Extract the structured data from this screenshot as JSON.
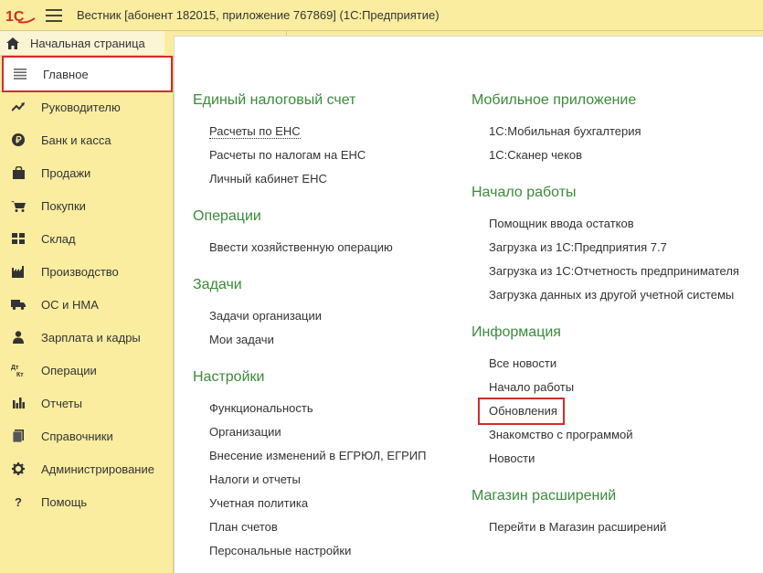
{
  "window": {
    "title": "Вестник [абонент 182015, приложение 767869]  (1С:Предприятие)",
    "logo_text": "1С"
  },
  "home": {
    "label": "Начальная страница"
  },
  "sidebar": {
    "items": [
      {
        "label": "Главное",
        "icon": "list-icon"
      },
      {
        "label": "Руководителю",
        "icon": "trend-icon"
      },
      {
        "label": "Банк и касса",
        "icon": "ruble-icon"
      },
      {
        "label": "Продажи",
        "icon": "bag-icon"
      },
      {
        "label": "Покупки",
        "icon": "cart-icon"
      },
      {
        "label": "Склад",
        "icon": "grid-icon"
      },
      {
        "label": "Производство",
        "icon": "factory-icon"
      },
      {
        "label": "ОС и НМА",
        "icon": "truck-icon"
      },
      {
        "label": "Зарплата и кадры",
        "icon": "person-icon"
      },
      {
        "label": "Операции",
        "icon": "dt-kt-icon"
      },
      {
        "label": "Отчеты",
        "icon": "bar-chart-icon"
      },
      {
        "label": "Справочники",
        "icon": "book-icon"
      },
      {
        "label": "Администрирование",
        "icon": "gear-icon"
      },
      {
        "label": "Помощь",
        "icon": "question-icon"
      }
    ],
    "dt_kt": {
      "dt": "Дт",
      "kt": "Кт"
    }
  },
  "main": {
    "left_column": [
      {
        "title": "Единый налоговый счет",
        "links": [
          "Расчеты по ЕНС",
          "Расчеты по налогам на ЕНС",
          "Личный кабинет ЕНС"
        ]
      },
      {
        "title": "Операции",
        "links": [
          "Ввести хозяйственную операцию"
        ]
      },
      {
        "title": "Задачи",
        "links": [
          "Задачи организации",
          "Мои задачи"
        ]
      },
      {
        "title": "Настройки",
        "links": [
          "Функциональность",
          "Организации",
          "Внесение изменений в ЕГРЮЛ, ЕГРИП",
          "Налоги и отчеты",
          "Учетная политика",
          "План счетов",
          "Персональные настройки"
        ]
      }
    ],
    "right_column": [
      {
        "title": "Мобильное приложение",
        "links": [
          "1С:Мобильная бухгалтерия",
          "1С:Сканер чеков"
        ]
      },
      {
        "title": "Начало работы",
        "links": [
          "Помощник ввода остатков",
          "Загрузка из 1С:Предприятия 7.7",
          "Загрузка из 1С:Отчетность предпринимателя",
          "Загрузка данных из другой учетной системы"
        ]
      },
      {
        "title": "Информация",
        "links": [
          "Все новости",
          "Начало работы",
          "Обновления",
          "Знакомство с программой",
          "Новости"
        ]
      },
      {
        "title": "Магазин расширений",
        "links": [
          "Перейти в Магазин расширений"
        ]
      }
    ]
  },
  "colors": {
    "sidebar_bg": "#fbeda0",
    "section_title": "#3a8b3a",
    "highlight_border": "#d42b2b"
  }
}
